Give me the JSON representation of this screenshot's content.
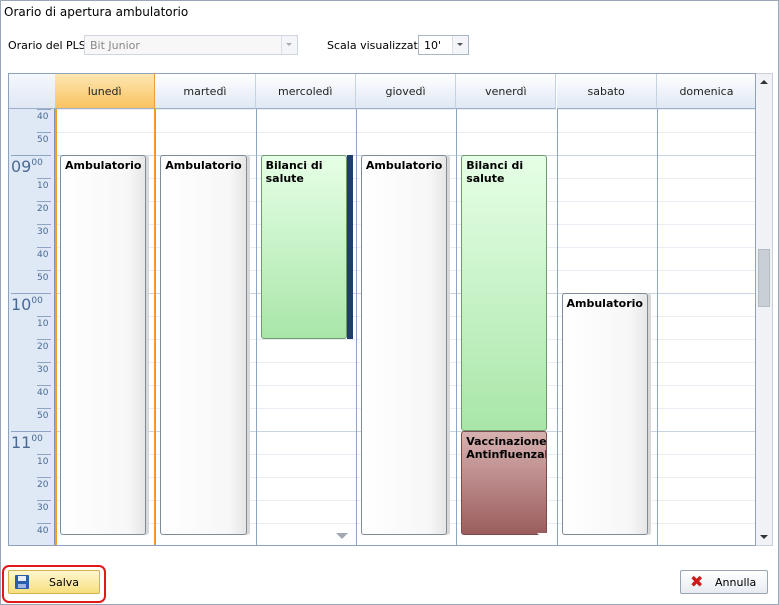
{
  "window": {
    "title": "Orario di apertura ambulatorio"
  },
  "toolbar": {
    "pls_label": "Orario del PLS:",
    "pls_value": "Bit Junior",
    "scale_label": "Scala visualizzata:",
    "scale_value": "10'"
  },
  "calendar": {
    "days": [
      "lunedì",
      "martedì",
      "mercoledì",
      "giovedì",
      "venerdì",
      "sabato",
      "domenica"
    ],
    "today_index": 0,
    "time_labels": [
      {
        "kind": "min",
        "text": "40"
      },
      {
        "kind": "min",
        "text": "50"
      },
      {
        "kind": "hour",
        "hour": "09",
        "min": "00"
      },
      {
        "kind": "min",
        "text": "10"
      },
      {
        "kind": "min",
        "text": "20"
      },
      {
        "kind": "min",
        "text": "30"
      },
      {
        "kind": "min",
        "text": "40"
      },
      {
        "kind": "min",
        "text": "50"
      },
      {
        "kind": "hour",
        "hour": "10",
        "min": "00"
      },
      {
        "kind": "min",
        "text": "10"
      },
      {
        "kind": "min",
        "text": "20"
      },
      {
        "kind": "min",
        "text": "30"
      },
      {
        "kind": "min",
        "text": "40"
      },
      {
        "kind": "min",
        "text": "50"
      },
      {
        "kind": "hour",
        "hour": "11",
        "min": "00"
      },
      {
        "kind": "min",
        "text": "10"
      },
      {
        "kind": "min",
        "text": "20"
      },
      {
        "kind": "min",
        "text": "30"
      },
      {
        "kind": "min",
        "text": "40"
      }
    ],
    "appointments": [
      {
        "day": 0,
        "start": "09:00",
        "end": "11:45",
        "label": "Ambulatorio",
        "color": "white"
      },
      {
        "day": 1,
        "start": "09:00",
        "end": "11:45",
        "label": "Ambulatorio",
        "color": "white"
      },
      {
        "day": 2,
        "start": "09:00",
        "end": "10:20",
        "label": "Bilanci di salute",
        "color": "green"
      },
      {
        "day": 3,
        "start": "09:00",
        "end": "11:45",
        "label": "Ambulatorio",
        "color": "white"
      },
      {
        "day": 4,
        "start": "09:00",
        "end": "11:00",
        "label": "Bilanci di salute",
        "color": "green"
      },
      {
        "day": 4,
        "start": "11:00",
        "end": "11:45",
        "label": "Vaccinazione Antinfluenzale",
        "color": "mauve"
      },
      {
        "day": 5,
        "start": "10:00",
        "end": "11:45",
        "label": "Ambulatorio",
        "color": "white"
      }
    ],
    "more_indicators": [
      {
        "day": 2,
        "color": "grey"
      },
      {
        "day": 4,
        "color": "white"
      }
    ],
    "colors": {
      "white": "#ffffff",
      "green": "#a9e6a9",
      "mauve": "#9b5d5d",
      "today_header": "#f9c261",
      "navy": "#1f3d6e"
    }
  },
  "footer": {
    "save_label": "Salva",
    "cancel_label": "Annulla"
  }
}
